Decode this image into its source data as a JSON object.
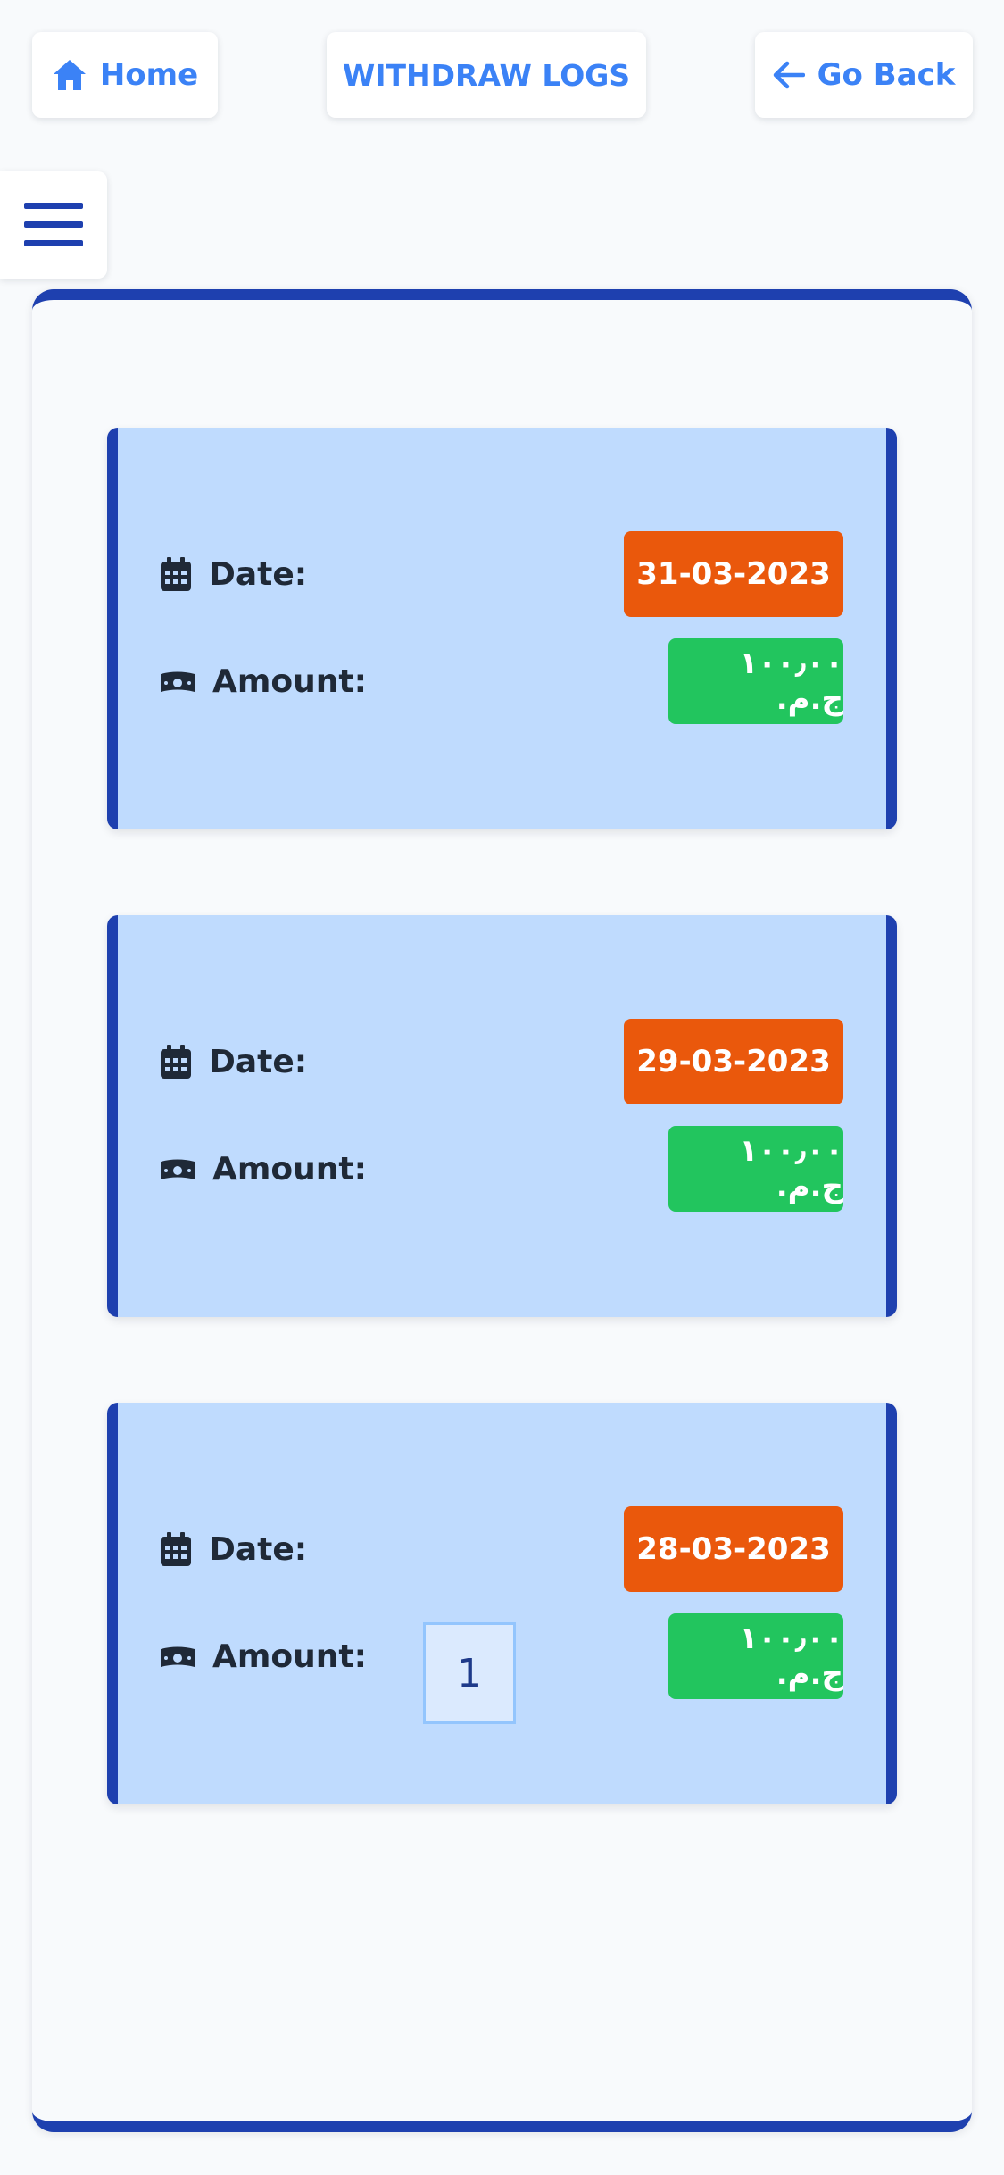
{
  "header": {
    "home_label": "Home",
    "title": "WITHDRAW LOGS",
    "back_label": "Go Back",
    "accent_color": "#3b82f6"
  },
  "menu": {
    "icon": "hamburger-icon"
  },
  "logs": {
    "date_label": "Date:",
    "amount_label": "Amount:",
    "items": [
      {
        "date": "31-03-2023",
        "amount": "١٠٠٫٠٠ ج.م."
      },
      {
        "date": "29-03-2023",
        "amount": "١٠٠٫٠٠ ج.م."
      },
      {
        "date": "28-03-2023",
        "amount": "١٠٠٫٠٠ ج.م."
      }
    ],
    "colors": {
      "card_bg": "#bfdbfe",
      "card_border": "#1e40af",
      "date_badge": "#ea580c",
      "amount_badge": "#22c55e"
    }
  },
  "pagination": {
    "current_page": "1"
  }
}
